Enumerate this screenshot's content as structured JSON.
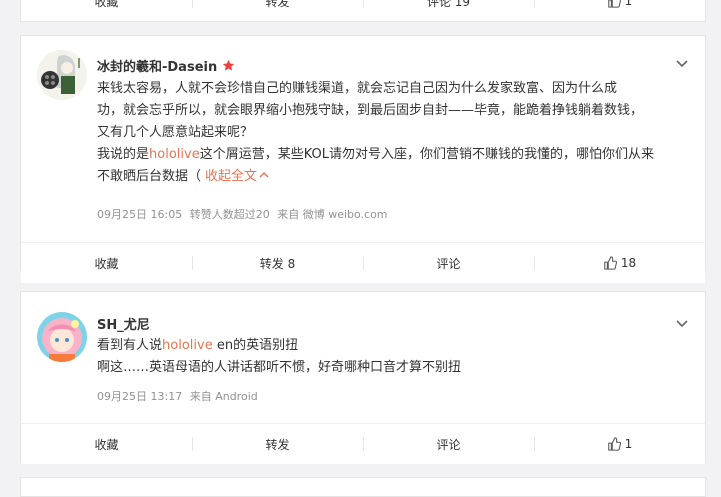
{
  "top_bar": {
    "collect": "收藏",
    "repost": "转发",
    "comment": "评论 19",
    "like": "1"
  },
  "post1": {
    "username": "冰封的羲和-Dasein",
    "text1": "来钱太容易，人就不会珍惜自己的赚钱渠道，就会忘记自己因为什么发家致富、因为什么成",
    "text2": "功，就会忘乎所以，就会眼界缩小抱残守缺，到最后固步自封——毕竟，能跪着挣钱躺着数钱，",
    "text3": "又有几个人愿意站起来呢？",
    "text4_pre": "我说的是",
    "text4_hl": "hololive",
    "text4_post": "这个屑运营，某些KOL请勿对号入座，你们营销不赚钱的我懂的，哪怕你们从来",
    "text5": "不敢晒后台数据（",
    "collapse": "收起全文",
    "meta_time": "09月25日 16:05",
    "meta_likes": "转赞人数超过20",
    "meta_from": "来自 微博 weibo.com",
    "actions": {
      "collect": "收藏",
      "repost": "转发 8",
      "comment": "评论",
      "like": "18"
    }
  },
  "post2": {
    "username": "SH_尤尼",
    "line1_pre": "看到有人说",
    "line1_hl": "hololive",
    "line1_post": " en的英语别扭",
    "line2": "啊这……英语母语的人讲话都听不惯，好奇哪种口音才算不别扭",
    "meta_time": "09月25日 13:17",
    "meta_from": "来自 Android",
    "actions": {
      "collect": "收藏",
      "repost": "转发",
      "comment": "评论",
      "like": "1"
    }
  },
  "colors": {
    "accent": "#eb7350",
    "meta": "#939393",
    "bg": "#f2f2f5"
  }
}
